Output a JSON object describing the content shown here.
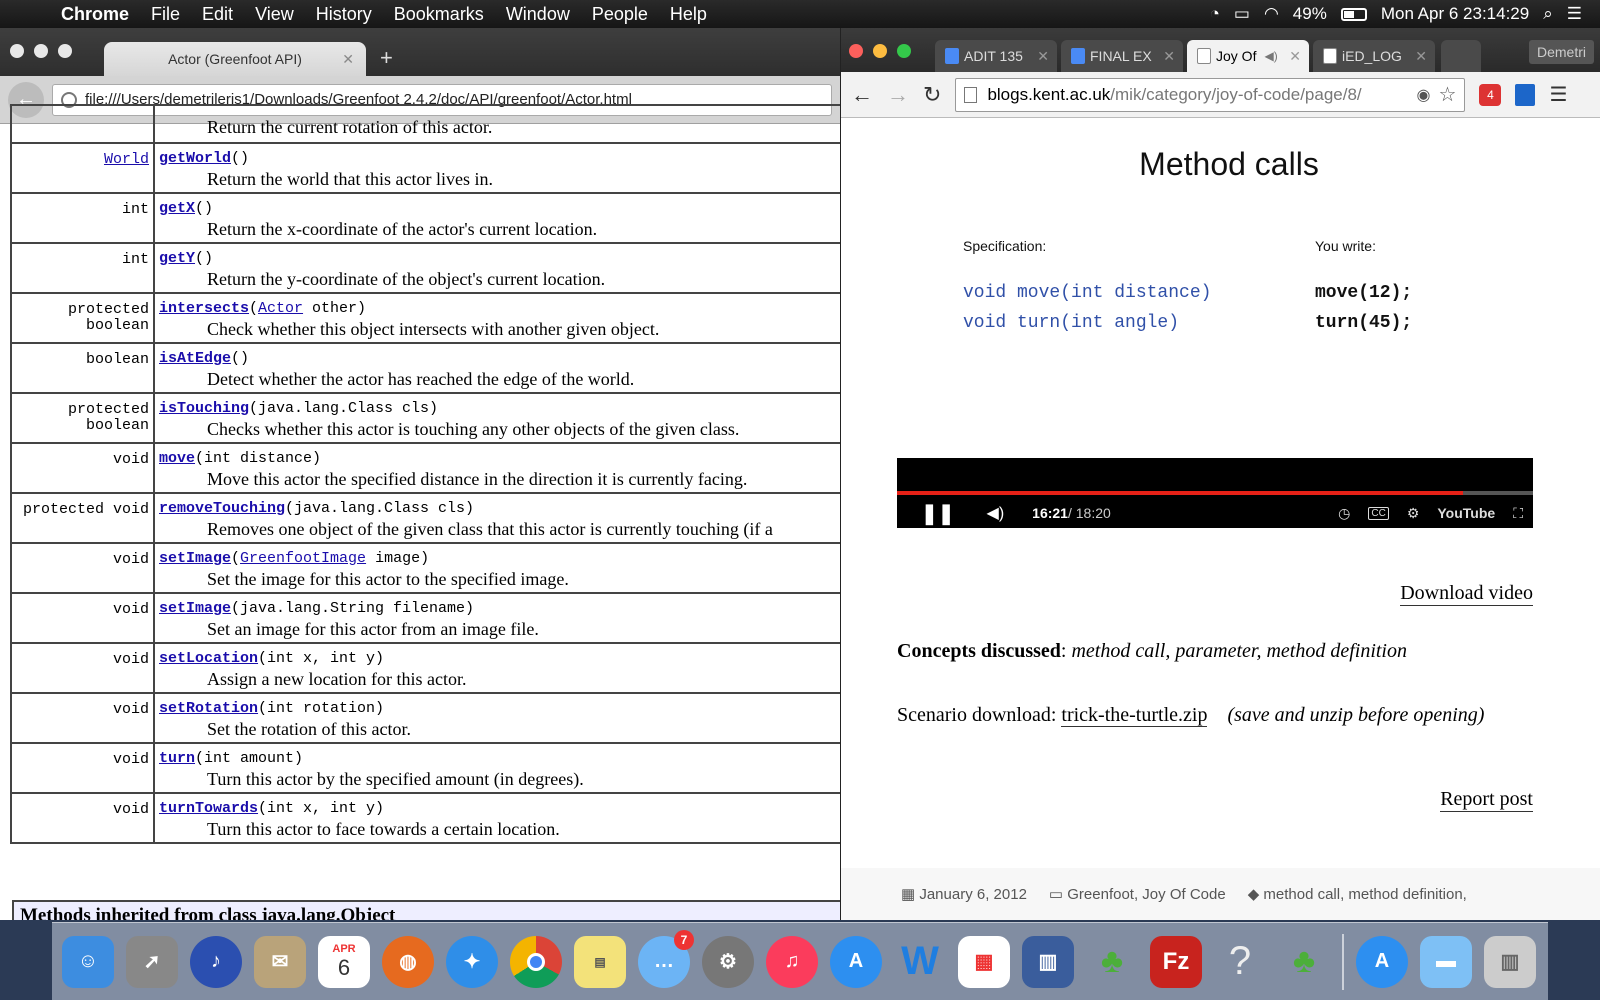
{
  "menubar": {
    "app": "Chrome",
    "items": [
      "File",
      "Edit",
      "View",
      "History",
      "Bookmarks",
      "Window",
      "People",
      "Help"
    ],
    "battery": "49%",
    "clock": "Mon Apr 6  23:14:29"
  },
  "left_window": {
    "tab_title": "Actor (Greenfoot API)",
    "url": "file:///Users/demetrileris1/Downloads/Greenfoot 2.4.2/doc/API/greenfoot/Actor.html",
    "partial_desc": "Return the current rotation of this actor.",
    "rows": [
      {
        "mod": "World",
        "name": "getWorld",
        "params": "()",
        "desc": "Return the world that this actor lives in."
      },
      {
        "mod": "int",
        "name": "getX",
        "params": "()",
        "desc": "Return the x-coordinate of the actor's current location."
      },
      {
        "mod": "int",
        "name": "getY",
        "params": "()",
        "desc": "Return the y-coordinate of the object's current location."
      },
      {
        "mod": "protected\nboolean",
        "name": "intersects",
        "params": "(Actor other)",
        "desc": "Check whether this object intersects with another given object."
      },
      {
        "mod": "boolean",
        "name": "isAtEdge",
        "params": "()",
        "desc": "Detect whether the actor has reached the edge of the world."
      },
      {
        "mod": "protected\nboolean",
        "name": "isTouching",
        "params": "(java.lang.Class cls)",
        "desc": "Checks whether this actor is touching any other objects of the given class."
      },
      {
        "mod": "void",
        "name": "move",
        "params": "(int distance)",
        "desc": "Move this actor the specified distance in the direction it is currently facing."
      },
      {
        "mod": "protected  void",
        "name": "removeTouching",
        "params": "(java.lang.Class cls)",
        "desc": "Removes one object of the given class that this actor is currently touching (if a"
      },
      {
        "mod": "void",
        "name": "setImage",
        "params": "(GreenfootImage image)",
        "desc": "Set the image for this actor to the specified image."
      },
      {
        "mod": "void",
        "name": "setImage",
        "params": "(java.lang.String filename)",
        "desc": "Set an image for this actor from an image file."
      },
      {
        "mod": "void",
        "name": "setLocation",
        "params": "(int x, int y)",
        "desc": "Assign a new location for this actor."
      },
      {
        "mod": "void",
        "name": "setRotation",
        "params": "(int rotation)",
        "desc": "Set the rotation of this actor."
      },
      {
        "mod": "void",
        "name": "turn",
        "params": "(int amount)",
        "desc": "Turn this actor by the specified amount (in degrees)."
      },
      {
        "mod": "void",
        "name": "turnTowards",
        "params": "(int x, int y)",
        "desc": "Turn this actor to face towards a certain location."
      }
    ],
    "inherited_title": "Methods inherited from class java.lang.Object"
  },
  "right_window": {
    "tabs": [
      "ADIT 135",
      "FINAL EX",
      "Joy Of",
      "iED_LOG"
    ],
    "profile": "Demetri",
    "url_host": "blogs.kent.ac.uk",
    "url_path": "/mik/category/joy-of-code/page/8/",
    "extension_badge": "4",
    "slide": {
      "title": "Method calls",
      "spec_label": "Specification:",
      "write_label": "You write:",
      "spec_lines": [
        "void move(int distance)",
        "void turn(int angle)"
      ],
      "write_lines": [
        "move(12);",
        "turn(45);"
      ]
    },
    "video": {
      "current": "16:21",
      "duration": " / 18:20",
      "progress": 0.89,
      "brand": "YouTube",
      "cc": "CC"
    },
    "download": "Download video",
    "concepts_label": "Concepts discussed",
    "concepts_value": "method call, parameter, method definition",
    "scenario_label": "Scenario download: ",
    "scenario_file": "trick-the-turtle.zip",
    "scenario_note": "(save and unzip before opening)",
    "report": "Report post",
    "date": "January 6, 2012",
    "categories": "Greenfoot, Joy Of Code",
    "tags": "method call, method definition,"
  },
  "dock": {
    "calendar_month": "APR",
    "calendar_day": "6",
    "messages_badge": "7",
    "filezilla": "Fz",
    "help": "?"
  },
  "colors": {
    "link": "#1a0dab",
    "code_blue": "#3050a8",
    "progress_red": "#e62117"
  }
}
